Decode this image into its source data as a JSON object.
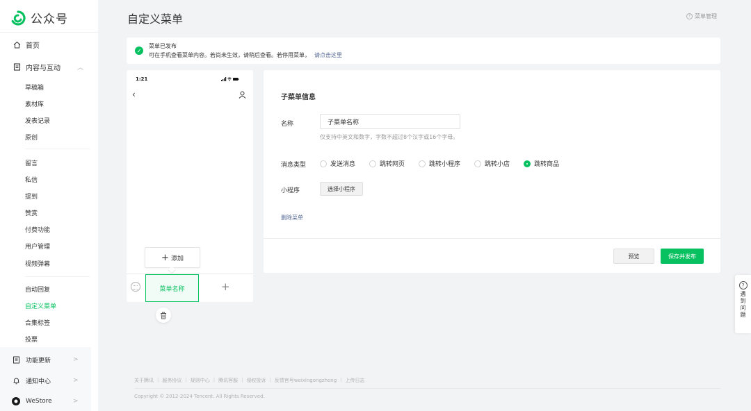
{
  "sidebar": {
    "brand": "公众号",
    "home": "首页",
    "content_group": "内容与互动",
    "content_items": [
      "草稿箱",
      "素材库",
      "发表记录",
      "原创"
    ],
    "interact_items": [
      "留言",
      "私信",
      "提到",
      "赞赏",
      "付费功能",
      "用户管理",
      "视频弹幕"
    ],
    "auto_items": [
      "自动回复",
      "自定义菜单",
      "合集标签",
      "投票"
    ],
    "active_item": "自定义菜单",
    "bottom": [
      "功能更新",
      "通知中心",
      "WeStore"
    ]
  },
  "header": {
    "title": "自定义菜单",
    "menu_mgmt": "菜单管理"
  },
  "notice": {
    "title": "菜单已发布",
    "desc": "可在手机查看菜单内容。若尚未生效，请稍后查看。若停用菜单，",
    "link": "请点击这里"
  },
  "phone": {
    "time": "1:21",
    "add_label": "添加",
    "menu_name": "菜单名称"
  },
  "form": {
    "section_title": "子菜单信息",
    "name_label": "名称",
    "name_value": "子菜单名称",
    "name_hint": "仅支持中英文和数字，字数不超过8个汉字或16个字母。",
    "type_label": "消息类型",
    "type_options": [
      "发送消息",
      "跳转网页",
      "跳转小程序",
      "跳转小店",
      "跳转商品"
    ],
    "type_selected": "跳转商品",
    "mini_label": "小程序",
    "select_mini": "选择小程序",
    "delete": "删除菜单",
    "preview": "预览",
    "save_publish": "保存并发布"
  },
  "help": {
    "chars": [
      "遇",
      "到",
      "问",
      "题"
    ]
  },
  "footer": {
    "links": [
      "关于腾讯",
      "服务协议",
      "规则中心",
      "腾讯客服",
      "侵权投诉",
      "反馈官号weixingongzhong",
      "上传日志"
    ],
    "copyright": "Copyright © 2012-2024 Tencent. All Rights Reserved."
  },
  "colors": {
    "accent": "#07c160",
    "link": "#576b95",
    "background": "#f2f3f5"
  }
}
